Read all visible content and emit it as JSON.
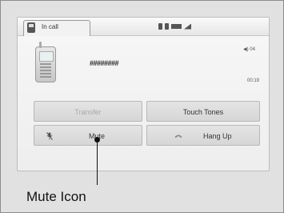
{
  "status_bar": {
    "tab_label": "In call"
  },
  "call": {
    "number": "########",
    "volume_label": "04",
    "timer": "00:19"
  },
  "buttons": {
    "transfer": "Transfer",
    "touch_tones": "Touch Tones",
    "mute": "Mute",
    "hang_up": "Hang Up"
  },
  "icons": {
    "tab": "phone-icon",
    "status": [
      "bluetooth-icon",
      "bluetooth-icon",
      "battery-icon",
      "signal-icon"
    ],
    "mute": "mute-microphone-icon",
    "hang_up": "hang-up-icon"
  },
  "callout": {
    "label": "Mute Icon"
  }
}
